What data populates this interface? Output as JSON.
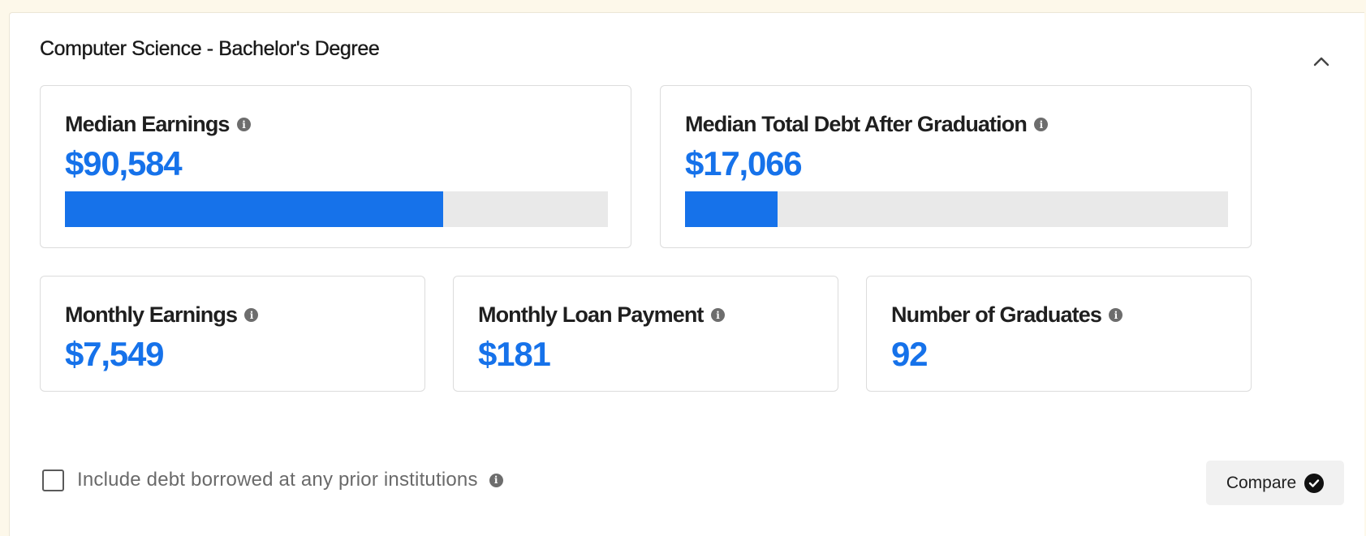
{
  "program": {
    "title": "Computer Science - Bachelor's Degree",
    "collapse_icon": "chevron-up-icon"
  },
  "median_earnings": {
    "label": "Median Earnings",
    "value": "$90,584",
    "bar_fraction": 0.697,
    "info_icon": "info-icon"
  },
  "median_debt": {
    "label": "Median Total Debt After Graduation",
    "value": "$17,066",
    "bar_fraction": 0.17,
    "info_icon": "info-icon"
  },
  "monthly_earnings": {
    "label": "Monthly Earnings",
    "value": "$7,549"
  },
  "monthly_loan": {
    "label": "Monthly Loan Payment",
    "value": "$181"
  },
  "graduates": {
    "label": "Number of Graduates",
    "value": "92"
  },
  "prior_debt": {
    "label": "Include debt borrowed at any prior institutions",
    "checked": false
  },
  "compare": {
    "label": "Compare",
    "icon": "check-circle-icon",
    "selected": true
  },
  "colors": {
    "accent": "#1672ea",
    "track": "#e9e9e9",
    "background": "#fdf8ea"
  }
}
